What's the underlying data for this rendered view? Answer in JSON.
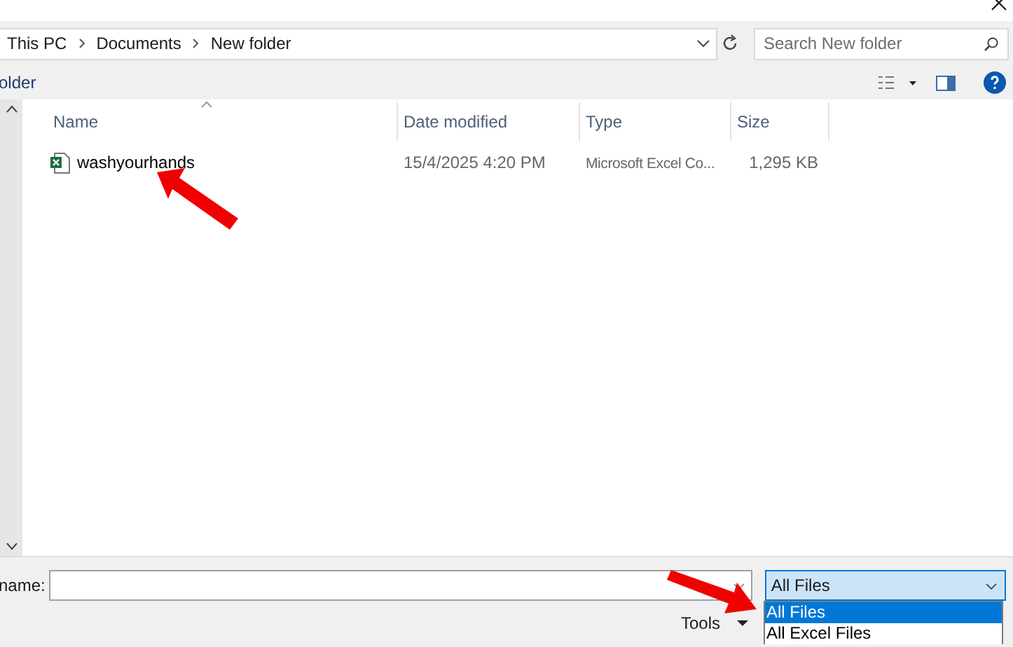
{
  "breadcrumb": [
    "This PC",
    "Documents",
    "New folder"
  ],
  "search": {
    "placeholder": "Search New folder"
  },
  "toolbar": {
    "label": "older"
  },
  "table": {
    "columns": [
      "Name",
      "Date modified",
      "Type",
      "Size"
    ],
    "rows": [
      {
        "name": "washyourhands",
        "date": "15/4/2025 4:20 PM",
        "type": "Microsoft Excel Co...",
        "size": "1,295 KB"
      }
    ]
  },
  "file_name": {
    "label": "name:"
  },
  "tools": {
    "label": "Tools"
  },
  "file_type": {
    "value": "All Files",
    "expanded": true,
    "options": [
      {
        "label": "All Files",
        "selected": true
      },
      {
        "label": "All Excel Files",
        "selected": false
      }
    ]
  }
}
